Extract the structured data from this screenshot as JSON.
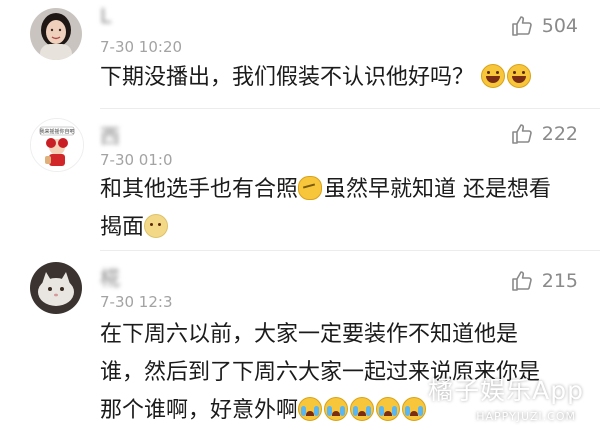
{
  "comments": [
    {
      "name": "L",
      "time": "7-30 10:20",
      "likes": "504",
      "text": "下期没播出，我们假装不认识他好吗？",
      "emojis": [
        "laugh",
        "laugh"
      ]
    },
    {
      "name": "西",
      "time": "7-30 01:0",
      "likes": "222",
      "text_line1": "和其他选手也有合照",
      "text_line1b": "虽然早就知道 还是想看",
      "text_line2": "揭面",
      "emojis": [
        "think",
        "meh"
      ]
    },
    {
      "name": "椛",
      "time": "7-30 12:3",
      "likes": "215",
      "text_line1": "在下周六以前，大家一定要装作不知道他是",
      "text_line2": "谁，然后到了下周六大家一起过来说原来你是",
      "text_line3": "那个谁啊，好意外啊",
      "emojis": [
        "cry",
        "cry",
        "cry",
        "cry",
        "cry"
      ]
    }
  ],
  "watermark": {
    "title": "橘子娱乐App",
    "sub": "HAPPYJUZI.COM"
  },
  "colors": {
    "text": "#1b1b1b",
    "meta": "#a3a3a3",
    "like": "#8a8a8a"
  }
}
